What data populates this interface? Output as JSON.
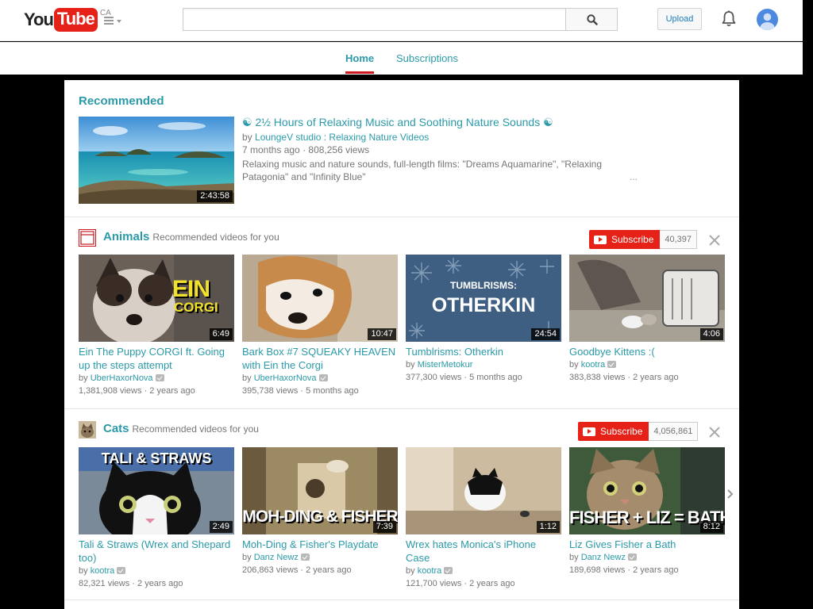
{
  "header": {
    "logo_you": "You",
    "logo_tube": "Tube",
    "logo_region": "CA",
    "search_placeholder": "",
    "upload_label": "Upload"
  },
  "tabs": [
    {
      "label": "Home",
      "active": true
    },
    {
      "label": "Subscriptions",
      "active": false
    }
  ],
  "recommended": {
    "heading": "Recommended",
    "video": {
      "title": "☯ 2½ Hours of Relaxing Music and Soothing Nature Sounds ☯",
      "by_prefix": "by",
      "channel": "LoungeV studio : Relaxing Nature Videos",
      "age": "7 months ago",
      "views": "808,256 views",
      "description": "Relaxing music and nature sounds, full-length films: \"Dreams Aquamarine\", \"Relaxing Patagonia\" and \"Infinity Blue\"",
      "ellipsis": "...",
      "duration": "2:43:58"
    }
  },
  "shelves": [
    {
      "name": "Animals",
      "subtitle": "Recommended videos for you",
      "subscribe_label": "Subscribe",
      "subscriber_count": "40,397",
      "videos": [
        {
          "title": "Ein The Puppy CORGI ft. Going up the steps attempt",
          "channel": "UberHaxorNova",
          "verified": true,
          "views": "1,381,908 views",
          "age": "2 years ago",
          "duration": "6:49",
          "thumb_text1": "EIN",
          "thumb_text2": "CORGI"
        },
        {
          "title": "Bark Box #7 SQUEAKY HEAVEN with Ein the Corgi",
          "channel": "UberHaxorNova",
          "verified": true,
          "views": "395,738 views",
          "age": "5 months ago",
          "duration": "10:47"
        },
        {
          "title": "Tumblrisms: Otherkin",
          "channel": "MisterMetokur",
          "verified": false,
          "views": "377,300 views",
          "age": "5 months ago",
          "duration": "24:54",
          "thumb_text1": "TUMBLRISMS:",
          "thumb_text2": "OTHERKIN"
        },
        {
          "title": "Goodbye Kittens :(",
          "channel": "kootra",
          "verified": true,
          "views": "383,838 views",
          "age": "2 years ago",
          "duration": "4:06"
        }
      ]
    },
    {
      "name": "Cats",
      "subtitle": "Recommended videos for you",
      "subscribe_label": "Subscribe",
      "subscriber_count": "4,056,861",
      "videos": [
        {
          "title": "Tali & Straws (Wrex and Shepard too)",
          "channel": "kootra",
          "verified": true,
          "views": "82,321 views",
          "age": "2 years ago",
          "duration": "2:49",
          "thumb_text1": "TALI & STRAWS"
        },
        {
          "title": "Moh-Ding & Fisher's Playdate",
          "channel": "Danz Newz",
          "verified": true,
          "views": "206,863 views",
          "age": "2 years ago",
          "duration": "7:39",
          "thumb_text1": "MOH-DING & FISHER"
        },
        {
          "title": "Wrex hates Monica's iPhone Case",
          "channel": "kootra",
          "verified": true,
          "views": "121,700 views",
          "age": "2 years ago",
          "duration": "1:12"
        },
        {
          "title": "Liz Gives Fisher a Bath",
          "channel": "Danz Newz",
          "verified": true,
          "views": "189,698 views",
          "age": "2 years ago",
          "duration": "8:12",
          "thumb_text1": "FISHER + LIZ = BATH"
        }
      ]
    }
  ],
  "meta_separator": "·",
  "by_prefix": "by"
}
